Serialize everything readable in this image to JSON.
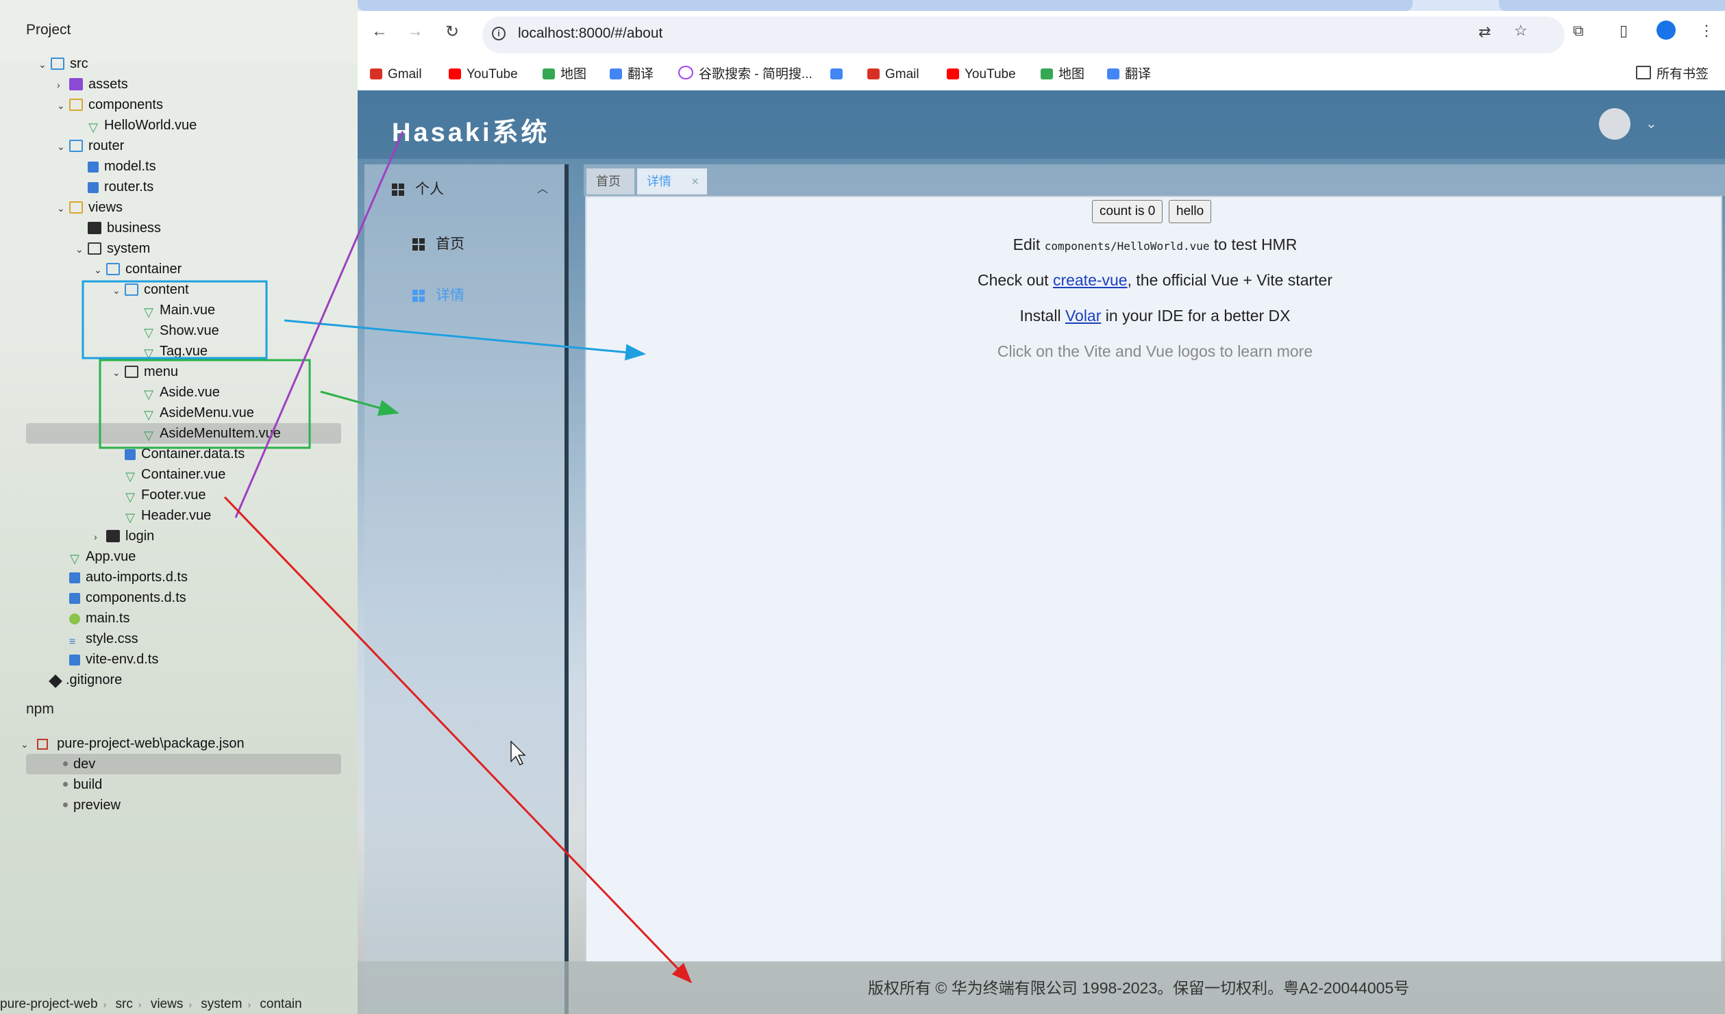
{
  "ide": {
    "panel_title": "Project",
    "tree": [
      {
        "name": "src",
        "depth": 1,
        "icon": "folder-icon",
        "expanded": true
      },
      {
        "name": "assets",
        "depth": 2,
        "icon": "folder-icon",
        "expanded": false
      },
      {
        "name": "components",
        "depth": 2,
        "icon": "folder-icon",
        "expanded": true
      },
      {
        "name": "HelloWorld.vue",
        "depth": 3,
        "icon": "vue-file-icon"
      },
      {
        "name": "router",
        "depth": 2,
        "icon": "folder-icon",
        "expanded": true
      },
      {
        "name": "model.ts",
        "depth": 3,
        "icon": "ts-file-icon"
      },
      {
        "name": "router.ts",
        "depth": 3,
        "icon": "ts-file-icon"
      },
      {
        "name": "views",
        "depth": 2,
        "icon": "folder-icon",
        "expanded": true
      },
      {
        "name": "business",
        "depth": 3,
        "icon": "folder-icon"
      },
      {
        "name": "system",
        "depth": 3,
        "icon": "folder-icon",
        "expanded": true
      },
      {
        "name": "container",
        "depth": 4,
        "icon": "folder-icon",
        "expanded": true
      },
      {
        "name": "content",
        "depth": 5,
        "icon": "folder-icon",
        "expanded": true
      },
      {
        "name": "Main.vue",
        "depth": 6,
        "icon": "vue-file-icon"
      },
      {
        "name": "Show.vue",
        "depth": 6,
        "icon": "vue-file-icon"
      },
      {
        "name": "Tag.vue",
        "depth": 6,
        "icon": "vue-file-icon"
      },
      {
        "name": "menu",
        "depth": 5,
        "icon": "folder-icon",
        "expanded": true
      },
      {
        "name": "Aside.vue",
        "depth": 6,
        "icon": "vue-file-icon"
      },
      {
        "name": "AsideMenu.vue",
        "depth": 6,
        "icon": "vue-file-icon"
      },
      {
        "name": "AsideMenuItem.vue",
        "depth": 6,
        "icon": "vue-file-icon"
      },
      {
        "name": "Container.data.ts",
        "depth": 5,
        "icon": "ts-file-icon"
      },
      {
        "name": "Container.vue",
        "depth": 5,
        "icon": "vue-file-icon"
      },
      {
        "name": "Footer.vue",
        "depth": 5,
        "icon": "vue-file-icon"
      },
      {
        "name": "Header.vue",
        "depth": 5,
        "icon": "vue-file-icon"
      },
      {
        "name": "login",
        "depth": 4,
        "icon": "folder-icon",
        "expanded": false
      },
      {
        "name": "App.vue",
        "depth": 2,
        "icon": "vue-file-icon"
      },
      {
        "name": "auto-imports.d.ts",
        "depth": 2,
        "icon": "ts-file-icon"
      },
      {
        "name": "components.d.ts",
        "depth": 2,
        "icon": "ts-file-icon"
      },
      {
        "name": "main.ts",
        "depth": 2,
        "icon": "node-file-icon"
      },
      {
        "name": "style.css",
        "depth": 2,
        "icon": "css-file-icon"
      },
      {
        "name": "vite-env.d.ts",
        "depth": 2,
        "icon": "ts-file-icon"
      },
      {
        "name": ".gitignore",
        "depth": 1,
        "icon": "git-file-icon"
      }
    ],
    "npm_title": "npm",
    "npm_package": "pure-project-web\\package.json",
    "npm_scripts": [
      "dev",
      "build",
      "preview"
    ],
    "breadcrumb": [
      "pure-project-web",
      "src",
      "views",
      "system",
      "contain"
    ]
  },
  "browser": {
    "url": "localhost:8000/#/about",
    "bookmarks": [
      {
        "label": "Gmail",
        "color": "#d93025"
      },
      {
        "label": "YouTube",
        "color": "#ff0000"
      },
      {
        "label": "地图",
        "color": "#34a853"
      },
      {
        "label": "翻译",
        "color": "#4285f4"
      },
      {
        "label": "谷歌搜索 - 简明搜...",
        "color": "#a142f4"
      },
      {
        "label": "",
        "color": "#4285f4"
      },
      {
        "label": "Gmail",
        "color": "#d93025"
      },
      {
        "label": "YouTube",
        "color": "#ff0000"
      },
      {
        "label": "地图",
        "color": "#34a853"
      },
      {
        "label": "翻译",
        "color": "#4285f4"
      }
    ],
    "all_bookmarks": "所有书签"
  },
  "app": {
    "title": "Hasaki系统",
    "aside": {
      "group_label": "个人",
      "items": [
        {
          "label": "首页",
          "active": false
        },
        {
          "label": "详情",
          "active": true
        }
      ]
    },
    "tags": {
      "home": "首页",
      "detail": "详情",
      "close": "×"
    },
    "content": {
      "count_button": "count is 0",
      "hello_button": "hello",
      "line1_pre": "Edit ",
      "line1_code": "components/HelloWorld.vue",
      "line1_post": " to test HMR",
      "line2_pre": "Check out ",
      "line2_link": "create-vue",
      "line2_post": ", the official Vue + Vite starter",
      "line3_pre": "Install ",
      "line3_link": "Volar",
      "line3_post": " in your IDE for a better DX",
      "line4": "Click on the Vite and Vue logos to learn more"
    },
    "footer": "版权所有 © 华为终端有限公司 1998-2023。保留一切权利。粤A2-20044005号"
  },
  "colors": {
    "accent": "#4a9cf0",
    "annotation_blue": "#1ea0e0",
    "annotation_green": "#2cb24a",
    "annotation_purple": "#a040c0",
    "annotation_red": "#e02020"
  }
}
